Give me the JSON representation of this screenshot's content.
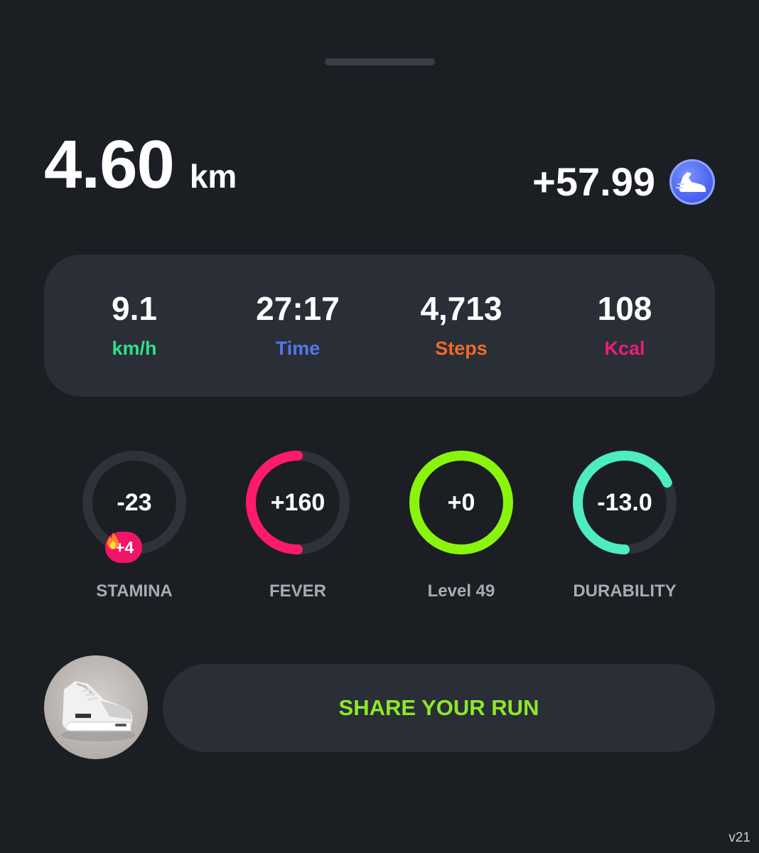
{
  "header": {
    "distance_value": "4.60",
    "distance_unit": "km",
    "reward_value": "+57.99",
    "token_icon": "running-shoe-token-icon"
  },
  "stats": [
    {
      "value": "9.1",
      "label": "km/h",
      "color": "#2fe08a"
    },
    {
      "value": "27:17",
      "label": "Time",
      "color": "#4f78f0"
    },
    {
      "value": "4,713",
      "label": "Steps",
      "color": "#f06a2a"
    },
    {
      "value": "108",
      "label": "Kcal",
      "color": "#ec1e7c"
    }
  ],
  "gauges": [
    {
      "value": "-23",
      "label": "STAMINA",
      "level": 0,
      "color": "#f0146a",
      "badge": {
        "icon": "flame-icon",
        "text": "+4"
      }
    },
    {
      "value": "+160",
      "label": "FEVER",
      "level": 0.5,
      "color": "#ff1a6c"
    },
    {
      "value": "+0",
      "label": "Level 49",
      "level": 1.0,
      "color": "#8af50c"
    },
    {
      "value": "-13.0",
      "label": "DURABILITY",
      "level": 0.68,
      "color": "#4dedc0"
    }
  ],
  "share_button": {
    "label": "SHARE YOUR RUN"
  },
  "version": "v21",
  "colors": {
    "background": "#1b1e23",
    "card": "#2a2e36",
    "ring_track": "#2e323a",
    "accent_green": "#8de82a"
  }
}
